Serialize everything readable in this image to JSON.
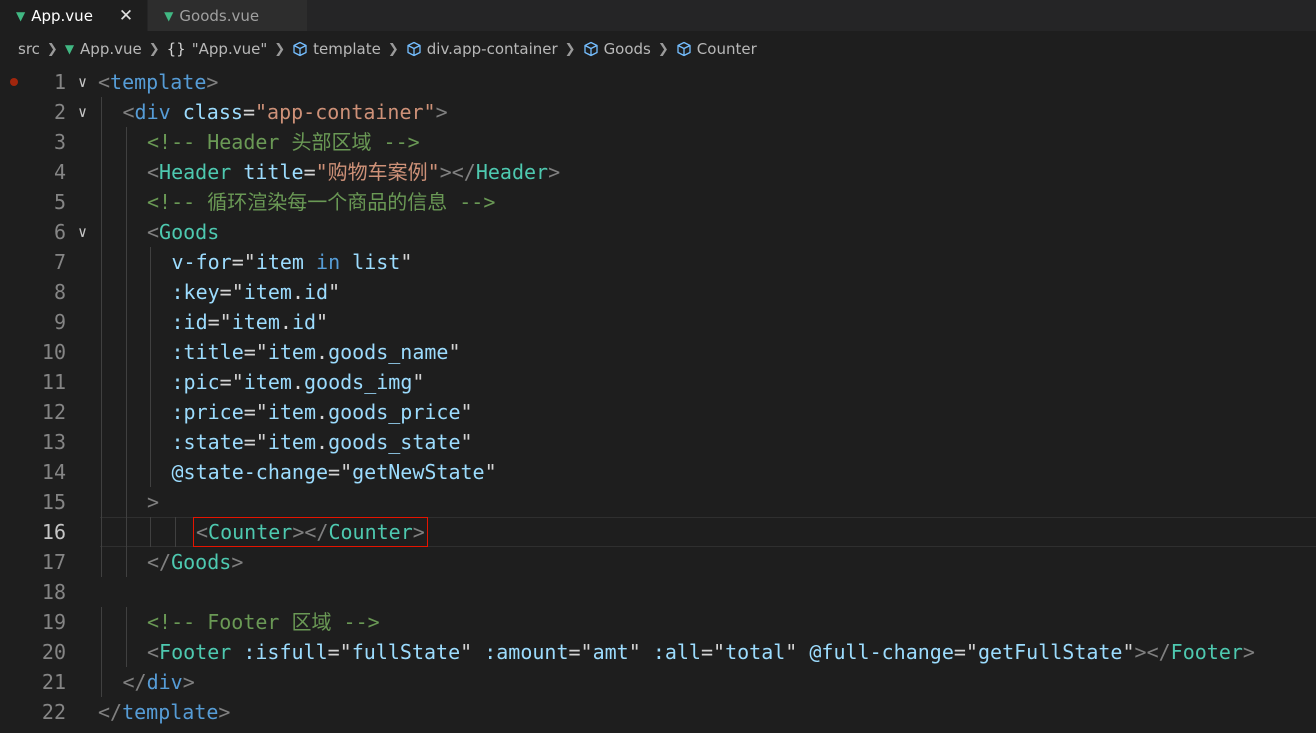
{
  "tabs": [
    {
      "label": "App.vue",
      "active": true
    },
    {
      "label": "Goods.vue",
      "active": false
    }
  ],
  "breadcrumb": [
    {
      "label": "src",
      "icon": ""
    },
    {
      "label": "App.vue",
      "icon": "vue-icon"
    },
    {
      "label": "\"App.vue\"",
      "icon": "braces-icon"
    },
    {
      "label": "template",
      "icon": "cube-icon"
    },
    {
      "label": "div.app-container",
      "icon": "cube-icon"
    },
    {
      "label": "Goods",
      "icon": "cube-icon"
    },
    {
      "label": "Counter",
      "icon": "cube-icon"
    }
  ],
  "editor": {
    "current_line": 16,
    "lines": [
      {
        "n": "1",
        "indent": 0,
        "fold": true,
        "breakpoint": true,
        "tokens": [
          [
            "bracket",
            "<"
          ],
          [
            "tag",
            "template"
          ],
          [
            "bracket",
            ">"
          ]
        ]
      },
      {
        "n": "2",
        "indent": 1,
        "fold": true,
        "tokens": [
          [
            "bracket",
            "<"
          ],
          [
            "tag",
            "div"
          ],
          [
            "plain",
            " "
          ],
          [
            "attr",
            "class"
          ],
          [
            "plain",
            "="
          ],
          [
            "str",
            "\"app-container\""
          ],
          [
            "bracket",
            ">"
          ]
        ]
      },
      {
        "n": "3",
        "indent": 2,
        "tokens": [
          [
            "comment",
            "<!-- Header 头部区域 -->"
          ]
        ]
      },
      {
        "n": "4",
        "indent": 2,
        "tokens": [
          [
            "bracket",
            "<"
          ],
          [
            "comp",
            "Header"
          ],
          [
            "plain",
            " "
          ],
          [
            "attr",
            "title"
          ],
          [
            "plain",
            "="
          ],
          [
            "str",
            "\"购物车案例\""
          ],
          [
            "bracket",
            "></"
          ],
          [
            "comp",
            "Header"
          ],
          [
            "bracket",
            ">"
          ]
        ]
      },
      {
        "n": "5",
        "indent": 2,
        "tokens": [
          [
            "comment",
            "<!-- 循环渲染每一个商品的信息 -->"
          ]
        ]
      },
      {
        "n": "6",
        "indent": 2,
        "fold": true,
        "tokens": [
          [
            "bracket",
            "<"
          ],
          [
            "comp",
            "Goods"
          ]
        ]
      },
      {
        "n": "7",
        "indent": 3,
        "tokens": [
          [
            "attr",
            "v-for"
          ],
          [
            "plain",
            "=\""
          ],
          [
            "attr",
            "item"
          ],
          [
            "plain",
            " "
          ],
          [
            "kw",
            "in"
          ],
          [
            "plain",
            " "
          ],
          [
            "attr",
            "list"
          ],
          [
            "plain",
            "\""
          ]
        ]
      },
      {
        "n": "8",
        "indent": 3,
        "tokens": [
          [
            "attr",
            ":key"
          ],
          [
            "plain",
            "=\""
          ],
          [
            "attr",
            "item"
          ],
          [
            "plain",
            "."
          ],
          [
            "attr",
            "id"
          ],
          [
            "plain",
            "\""
          ]
        ]
      },
      {
        "n": "9",
        "indent": 3,
        "tokens": [
          [
            "attr",
            ":id"
          ],
          [
            "plain",
            "=\""
          ],
          [
            "attr",
            "item"
          ],
          [
            "plain",
            "."
          ],
          [
            "attr",
            "id"
          ],
          [
            "plain",
            "\""
          ]
        ]
      },
      {
        "n": "10",
        "indent": 3,
        "tokens": [
          [
            "attr",
            ":title"
          ],
          [
            "plain",
            "=\""
          ],
          [
            "attr",
            "item"
          ],
          [
            "plain",
            "."
          ],
          [
            "attr",
            "goods_name"
          ],
          [
            "plain",
            "\""
          ]
        ]
      },
      {
        "n": "11",
        "indent": 3,
        "tokens": [
          [
            "attr",
            ":pic"
          ],
          [
            "plain",
            "=\""
          ],
          [
            "attr",
            "item"
          ],
          [
            "plain",
            "."
          ],
          [
            "attr",
            "goods_img"
          ],
          [
            "plain",
            "\""
          ]
        ]
      },
      {
        "n": "12",
        "indent": 3,
        "tokens": [
          [
            "attr",
            ":price"
          ],
          [
            "plain",
            "=\""
          ],
          [
            "attr",
            "item"
          ],
          [
            "plain",
            "."
          ],
          [
            "attr",
            "goods_price"
          ],
          [
            "plain",
            "\""
          ]
        ]
      },
      {
        "n": "13",
        "indent": 3,
        "tokens": [
          [
            "attr",
            ":state"
          ],
          [
            "plain",
            "=\""
          ],
          [
            "attr",
            "item"
          ],
          [
            "plain",
            "."
          ],
          [
            "attr",
            "goods_state"
          ],
          [
            "plain",
            "\""
          ]
        ]
      },
      {
        "n": "14",
        "indent": 3,
        "tokens": [
          [
            "attr",
            "@state-change"
          ],
          [
            "plain",
            "=\""
          ],
          [
            "attr",
            "getNewState"
          ],
          [
            "plain",
            "\""
          ]
        ]
      },
      {
        "n": "15",
        "indent": 2,
        "tokens": [
          [
            "bracket",
            ">"
          ]
        ]
      },
      {
        "n": "16",
        "indent": 4,
        "highlight": true,
        "tokens": [
          [
            "bracket",
            "<"
          ],
          [
            "comp",
            "Counter"
          ],
          [
            "bracket",
            "></"
          ],
          [
            "comp",
            "Counter"
          ],
          [
            "bracket",
            ">"
          ]
        ]
      },
      {
        "n": "17",
        "indent": 2,
        "tokens": [
          [
            "bracket",
            "</"
          ],
          [
            "comp",
            "Goods"
          ],
          [
            "bracket",
            ">"
          ]
        ]
      },
      {
        "n": "18",
        "indent": 0,
        "tokens": []
      },
      {
        "n": "19",
        "indent": 2,
        "tokens": [
          [
            "comment",
            "<!-- Footer 区域 -->"
          ]
        ]
      },
      {
        "n": "20",
        "indent": 2,
        "tokens": [
          [
            "bracket",
            "<"
          ],
          [
            "comp",
            "Footer"
          ],
          [
            "plain",
            " "
          ],
          [
            "attr",
            ":isfull"
          ],
          [
            "plain",
            "=\""
          ],
          [
            "attr",
            "fullState"
          ],
          [
            "plain",
            "\" "
          ],
          [
            "attr",
            ":amount"
          ],
          [
            "plain",
            "=\""
          ],
          [
            "attr",
            "amt"
          ],
          [
            "plain",
            "\" "
          ],
          [
            "attr",
            ":all"
          ],
          [
            "plain",
            "=\""
          ],
          [
            "attr",
            "total"
          ],
          [
            "plain",
            "\" "
          ],
          [
            "attr",
            "@full-change"
          ],
          [
            "plain",
            "=\""
          ],
          [
            "attr",
            "getFullState"
          ],
          [
            "plain",
            "\""
          ],
          [
            "bracket",
            "></"
          ],
          [
            "comp",
            "Footer"
          ],
          [
            "bracket",
            ">"
          ]
        ]
      },
      {
        "n": "21",
        "indent": 1,
        "tokens": [
          [
            "bracket",
            "</"
          ],
          [
            "tag",
            "div"
          ],
          [
            "bracket",
            ">"
          ]
        ]
      },
      {
        "n": "22",
        "indent": 0,
        "tokens": [
          [
            "bracket",
            "</"
          ],
          [
            "tag",
            "template"
          ],
          [
            "bracket",
            ">"
          ]
        ]
      }
    ]
  },
  "colors": {
    "vue": "#41b883",
    "highlight_box": "#e51400"
  }
}
